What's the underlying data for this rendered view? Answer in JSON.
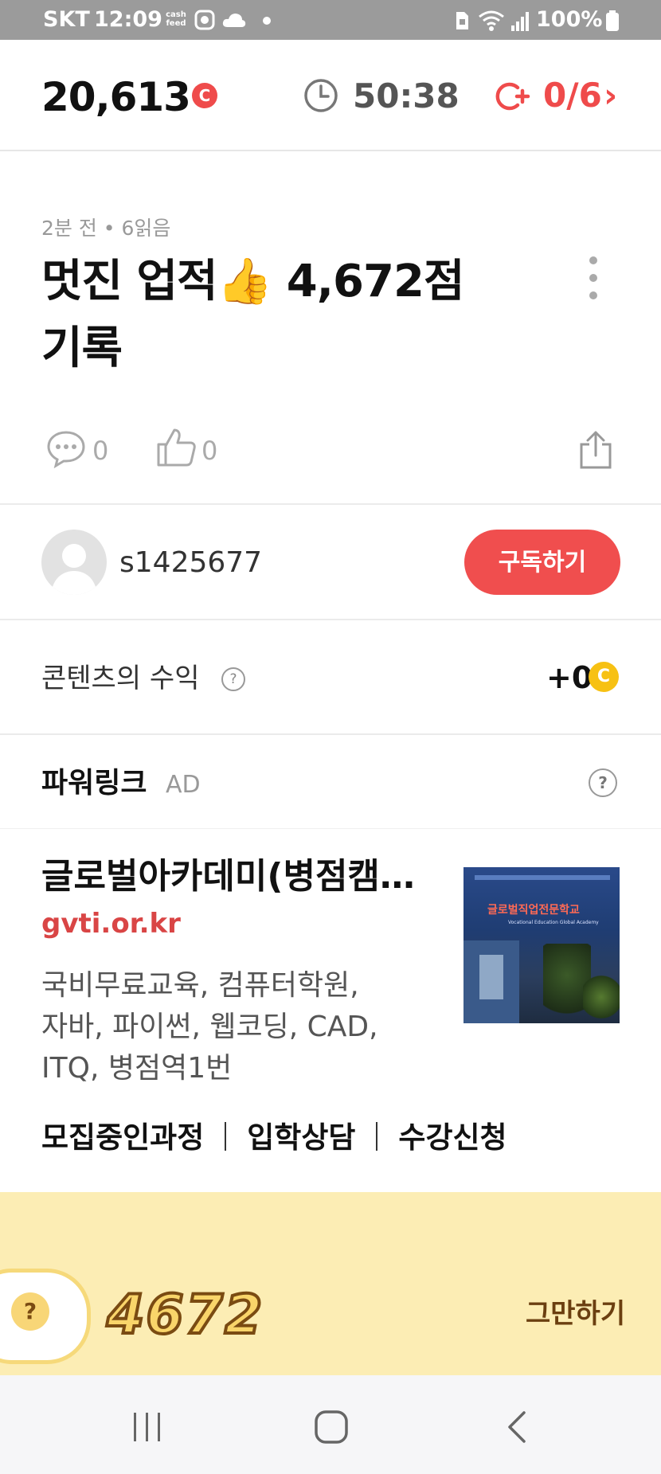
{
  "status_bar": {
    "carrier": "SKT",
    "time": "12:09",
    "cashfeed_line1": "cash",
    "cashfeed_line2": "feed",
    "battery": "100%"
  },
  "header": {
    "coin_total": "20,613",
    "coin_symbol": "C",
    "timer": "50:38",
    "quota": "0/6",
    "quota_arrow": "›"
  },
  "post": {
    "meta": "2분 전 • 6읽음",
    "title_part1": "멋진 업적",
    "title_emoji": "👍",
    "title_part2": " 4,672점",
    "title_line2": "기록",
    "comment_count": "0",
    "like_count": "0"
  },
  "author": {
    "username": "s1425677",
    "subscribe_label": "구독하기"
  },
  "earnings": {
    "label": "콘텐츠의 수익",
    "help": "?",
    "value": "+0",
    "coin_symbol": "C"
  },
  "powerlink": {
    "title": "파워링크",
    "ad_tag": "AD",
    "help": "?"
  },
  "ad": {
    "title": "글로벌아카데미(병점캠…",
    "url": "gvti.or.kr",
    "desc_line1": "국비무료교육, 컴퓨터학원,",
    "desc_line2": "자바, 파이썬, 웹코딩, CAD,",
    "desc_line3": "ITQ, 병점역1번",
    "image_sign": "글로벌직업전문학교",
    "image_subsign": "Vocational Education Global Academy",
    "links": [
      "모집중인과정",
      "입학상담",
      "수강신청"
    ]
  },
  "game": {
    "hint": "?",
    "score": "4672",
    "stop_label": "그만하기"
  },
  "colors": {
    "accent_red": "#f04e4e",
    "coin_yellow": "#f7c113",
    "ad_url": "#d94545",
    "game_bg": "#fcedb4"
  },
  "icons": [
    "wifi-icon",
    "signal-icon",
    "battery-icon",
    "cloud-icon",
    "clock-icon",
    "coin-plus-icon",
    "more-icon",
    "comment-icon",
    "like-icon",
    "share-icon",
    "recent-apps-icon",
    "home-icon",
    "back-icon"
  ]
}
